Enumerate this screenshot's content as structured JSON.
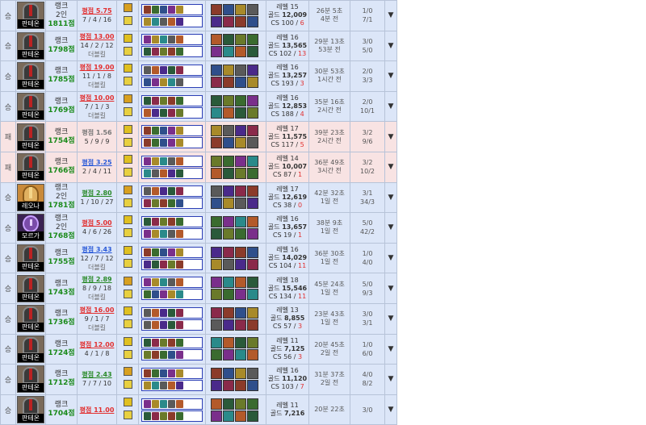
{
  "labels": {
    "level": "레벨",
    "gold": "골드",
    "cs": "CS"
  },
  "matches": [
    {
      "result": "승",
      "champ": "판테온",
      "portrait": "pantheon",
      "tier": "랭크",
      "sub": "2인",
      "pts": "1811점",
      "kdaLabel": "평점 5.75",
      "kdaStyle": "red",
      "kda": "7 / 4 / 16",
      "tag": "",
      "level": "15",
      "gold": "12,009",
      "csBase": "CS 100 / ",
      "csDiff": "6",
      "time": "26분 5초",
      "ago": "4분 전",
      "mk1": "1/0",
      "mk2": "7/1"
    },
    {
      "result": "승",
      "champ": "판테온",
      "portrait": "pantheon",
      "tier": "랭크",
      "sub": "",
      "pts": "1798점",
      "kdaLabel": "평점 13.00",
      "kdaStyle": "red",
      "kda": "14 / 2 / 12",
      "tag": "더블킬",
      "level": "16",
      "gold": "13,565",
      "csBase": "CS 102 / ",
      "csDiff": "13",
      "time": "29분 13초",
      "ago": "53분 전",
      "mk1": "3/0",
      "mk2": "5/0"
    },
    {
      "result": "승",
      "champ": "판테온",
      "portrait": "pantheon",
      "tier": "랭크",
      "sub": "",
      "pts": "1785점",
      "kdaLabel": "평점 19.00",
      "kdaStyle": "red",
      "kda": "11 / 1 / 8",
      "tag": "더블킬",
      "level": "16",
      "gold": "13,257",
      "csBase": "CS 193 / ",
      "csDiff": "3",
      "time": "30분 53초",
      "ago": "1시간 전",
      "mk1": "2/0",
      "mk2": "3/3"
    },
    {
      "result": "승",
      "champ": "판테온",
      "portrait": "pantheon",
      "tier": "랭크",
      "sub": "",
      "pts": "1769점",
      "kdaLabel": "평점 10.00",
      "kdaStyle": "red",
      "kda": "7 / 1 / 3",
      "tag": "더블킬",
      "level": "16",
      "gold": "12,853",
      "csBase": "CS 188 / ",
      "csDiff": "4",
      "time": "35분 16초",
      "ago": "2시간 전",
      "mk1": "2/0",
      "mk2": "10/1"
    },
    {
      "result": "패",
      "champ": "판테온",
      "portrait": "pantheon",
      "tier": "랭크",
      "sub": "",
      "pts": "1754점",
      "kdaLabel": "평점 1.56",
      "kdaStyle": "gray",
      "kda": "5 / 9 / 9",
      "tag": "",
      "level": "17",
      "gold": "11,575",
      "csBase": "CS 117 / ",
      "csDiff": "5",
      "time": "39분 23초",
      "ago": "2시간 전",
      "mk1": "3/2",
      "mk2": "9/6"
    },
    {
      "result": "패",
      "champ": "판테온",
      "portrait": "pantheon",
      "tier": "랭크",
      "sub": "",
      "pts": "1766점",
      "kdaLabel": "평점 3.25",
      "kdaStyle": "blue",
      "kda": "2 / 4 / 11",
      "tag": "",
      "level": "14",
      "gold": "10,007",
      "csBase": "CS 87 / ",
      "csDiff": "1",
      "time": "36분 49초",
      "ago": "3시간 전",
      "mk1": "3/2",
      "mk2": "10/2"
    },
    {
      "result": "승",
      "champ": "레오나",
      "portrait": "leona",
      "tier": "랭크",
      "sub": "2인",
      "pts": "1781점",
      "kdaLabel": "평점 2.80",
      "kdaStyle": "green",
      "kda": "1 / 10 / 27",
      "tag": "",
      "level": "17",
      "gold": "12,619",
      "csBase": "CS 38 / ",
      "csDiff": "0",
      "time": "42분 32초",
      "ago": "1일 전",
      "mk1": "3/1",
      "mk2": "34/3"
    },
    {
      "result": "승",
      "champ": "모르가",
      "portrait": "morgana",
      "tier": "랭크",
      "sub": "2인",
      "pts": "1768점",
      "kdaLabel": "평점 5.00",
      "kdaStyle": "red",
      "kda": "4 / 6 / 26",
      "tag": "",
      "level": "16",
      "gold": "13,657",
      "csBase": "CS 19 / ",
      "csDiff": "1",
      "time": "38분 9초",
      "ago": "1일 전",
      "mk1": "5/0",
      "mk2": "42/2"
    },
    {
      "result": "승",
      "champ": "판테온",
      "portrait": "pantheon",
      "tier": "랭크",
      "sub": "",
      "pts": "1755점",
      "kdaLabel": "평점 3.43",
      "kdaStyle": "blue",
      "kda": "12 / 7 / 12",
      "tag": "더블킬",
      "level": "16",
      "gold": "14,029",
      "csBase": "CS 104 / ",
      "csDiff": "11",
      "time": "36분 30초",
      "ago": "1일 전",
      "mk1": "1/0",
      "mk2": "4/0"
    },
    {
      "result": "승",
      "champ": "판테온",
      "portrait": "pantheon",
      "tier": "랭크",
      "sub": "",
      "pts": "1743점",
      "kdaLabel": "평점 2.89",
      "kdaStyle": "green",
      "kda": "8 / 9 / 18",
      "tag": "더블킬",
      "level": "18",
      "gold": "15,546",
      "csBase": "CS 134 / ",
      "csDiff": "11",
      "time": "45분 24초",
      "ago": "1일 전",
      "mk1": "5/0",
      "mk2": "9/3"
    },
    {
      "result": "승",
      "champ": "판테온",
      "portrait": "pantheon",
      "tier": "랭크",
      "sub": "",
      "pts": "1736점",
      "kdaLabel": "평점 16.00",
      "kdaStyle": "red",
      "kda": "9 / 1 / 7",
      "tag": "더블킬",
      "level": "13",
      "gold": "8,855",
      "csBase": "CS 57 / ",
      "csDiff": "3",
      "time": "23분 43초",
      "ago": "1일 전",
      "mk1": "3/0",
      "mk2": "3/1"
    },
    {
      "result": "승",
      "champ": "판테온",
      "portrait": "pantheon",
      "tier": "랭크",
      "sub": "",
      "pts": "1724점",
      "kdaLabel": "평점 12.00",
      "kdaStyle": "red",
      "kda": "4 / 1 / 8",
      "tag": "",
      "level": "11",
      "gold": "7,125",
      "csBase": "CS 56 / ",
      "csDiff": "3",
      "time": "20분 45초",
      "ago": "2일 전",
      "mk1": "1/0",
      "mk2": "6/0"
    },
    {
      "result": "승",
      "champ": "판테온",
      "portrait": "pantheon",
      "tier": "랭크",
      "sub": "",
      "pts": "1712점",
      "kdaLabel": "평점 2.43",
      "kdaStyle": "green",
      "kda": "7 / 7 / 10",
      "tag": "",
      "level": "16",
      "gold": "11,120",
      "csBase": "CS 103 / ",
      "csDiff": "7",
      "time": "31분 37초",
      "ago": "2일 전",
      "mk1": "4/0",
      "mk2": "8/2"
    },
    {
      "result": "승",
      "champ": "판테온",
      "portrait": "pantheon",
      "tier": "랭크",
      "sub": "",
      "pts": "1704점",
      "kdaLabel": "평점 11.00",
      "kdaStyle": "red",
      "kda": "",
      "tag": "",
      "level": "11",
      "gold": "7,216",
      "csBase": "",
      "csDiff": "",
      "time": "20분 22초",
      "ago": "",
      "mk1": "3/0",
      "mk2": ""
    }
  ],
  "colors": {
    "win_bg": "#dce6f8",
    "loss_bg": "#f8e3e3",
    "team_border": "#2b3eb5",
    "kda_red": "#e23030",
    "kda_blue": "#2a5ad8",
    "kda_green": "#2a8a2a",
    "points_green": "#1a8a1a"
  },
  "icons": {
    "expand": "▼",
    "spell_flash": "flash-spell-icon",
    "spell_ignite": "ignite-spell-icon"
  }
}
